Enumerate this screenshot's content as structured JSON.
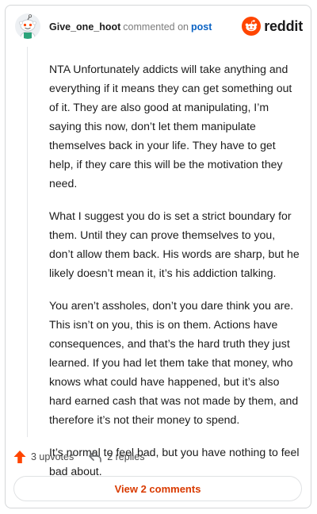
{
  "comment": {
    "username": "Give_one_hoot",
    "verb": "commented on",
    "post_link": "post",
    "avatar_icon": "reddit-snoo-avatar-icon",
    "paragraphs": [
      "NTA Unfortunately addicts will take anything and everything if it means they can get something out of it. They are also good at manipulating, I’m saying this now, don’t let them manipulate themselves back in your life. They have to get help, if they care this will be the motivation they need.",
      "What I suggest you do is set a strict boundary for them. Until they can prove themselves to you, don’t allow them back. His words are sharp, but he likely doesn’t mean it, it’s his addiction talking.",
      "You aren’t assholes, don’t you dare think you are. This isn’t on you, this is on them. Actions have consequences, and that’s the hard truth they just learned. If you had let them take that money, who knows what could have happened, but it’s also hard earned cash that was not made by them, and therefore it’s not their money to spend.",
      "It’s normal to feel bad, but you have nothing to feel bad about."
    ]
  },
  "brand": {
    "wordmark": "reddit",
    "icon": "reddit-logo-icon",
    "color": "#ff4500"
  },
  "actions": {
    "upvotes": "3 upvotes",
    "upvote_icon": "upvote-arrow-icon",
    "replies": "2 replies",
    "reply_icon": "reply-arrow-icon"
  },
  "footer": {
    "view_comments": "View 2 comments",
    "accent": "#d93a00"
  }
}
